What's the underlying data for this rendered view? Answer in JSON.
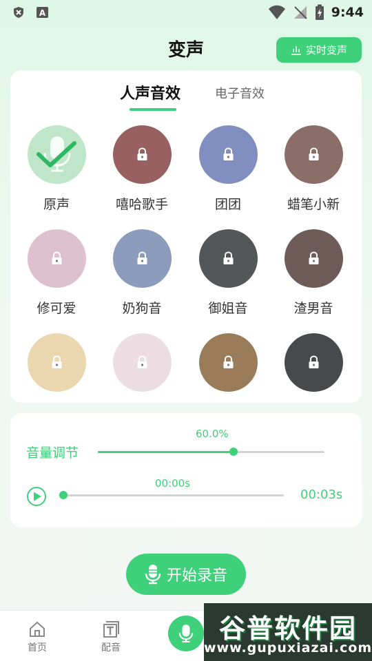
{
  "status_bar": {
    "time": "9:44",
    "icons": [
      "shield-x-icon",
      "a-box-icon",
      "wifi-icon",
      "signal-off-icon",
      "battery-charging-icon"
    ]
  },
  "header": {
    "title": "变声",
    "realtime_button": "实时变声"
  },
  "tabs": [
    {
      "label": "人声音效",
      "active": true
    },
    {
      "label": "电子音效",
      "active": false
    }
  ],
  "effects": [
    {
      "label": "原声",
      "locked": false,
      "selected": true,
      "color": "#bfe6c9"
    },
    {
      "label": "嘻哈歌手",
      "locked": true,
      "color": "#8a4a4a"
    },
    {
      "label": "团团",
      "locked": true,
      "color": "#6f7fb8"
    },
    {
      "label": "蜡笔小新",
      "locked": true,
      "color": "#7a5a52"
    },
    {
      "label": "修可爱",
      "locked": true,
      "color": "#d9b9c6"
    },
    {
      "label": "奶狗音",
      "locked": true,
      "color": "#7b8fb3"
    },
    {
      "label": "御姐音",
      "locked": true,
      "color": "#3d4040"
    },
    {
      "label": "渣男音",
      "locked": true,
      "color": "#5a4642"
    },
    {
      "label": "",
      "locked": true,
      "color": "#e9d2a4"
    },
    {
      "label": "",
      "locked": true,
      "color": "#e9d9dd"
    },
    {
      "label": "",
      "locked": true,
      "color": "#8c6a44"
    },
    {
      "label": "",
      "locked": true,
      "color": "#2f3032"
    }
  ],
  "volume": {
    "label": "音量调节",
    "value_text": "60.0%",
    "value": 0.6
  },
  "playback": {
    "current": "00:00s",
    "total": "00:03s",
    "progress": 0.0
  },
  "record_button": "开始录音",
  "nav": [
    {
      "label": "首页",
      "icon": "home-icon"
    },
    {
      "label": "配音",
      "icon": "text-icon"
    }
  ],
  "watermark": {
    "main": "谷普软件园",
    "sub": "www.gupuxiazai.com"
  },
  "colors": {
    "accent": "#3fd07a"
  }
}
